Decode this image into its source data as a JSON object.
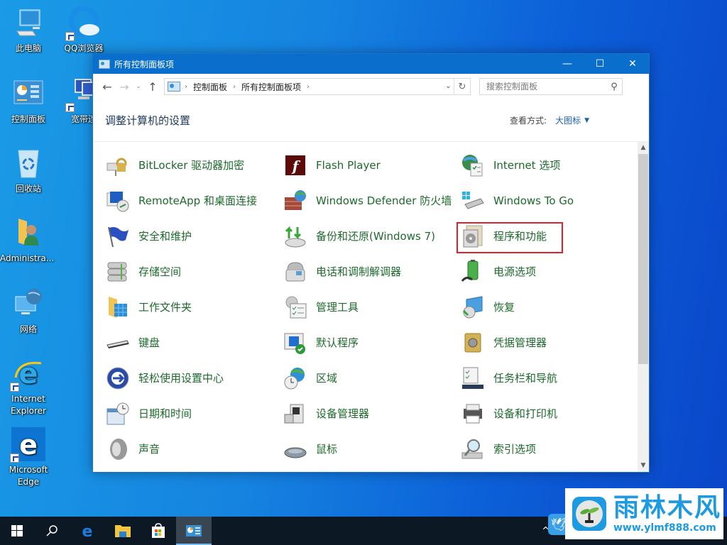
{
  "desktop": {
    "icons": [
      {
        "label": "此电脑",
        "icon": "computer-icon"
      },
      {
        "label": "QQ浏览器",
        "icon": "qq-browser-icon"
      },
      {
        "label": "控制面板",
        "icon": "control-panel-icon"
      },
      {
        "label": "宽带连",
        "icon": "broadband-icon"
      },
      {
        "label": "回收站",
        "icon": "recycle-bin-icon"
      },
      {
        "label": "Administra...",
        "icon": "user-folder-icon"
      },
      {
        "label": "网络",
        "icon": "network-icon"
      },
      {
        "label": "Internet Explorer",
        "icon": "ie-icon"
      },
      {
        "label": "Microsoft Edge",
        "icon": "edge-icon"
      }
    ]
  },
  "window": {
    "title": "所有控制面板项",
    "controls": {
      "minimize": "—",
      "maximize": "☐",
      "close": "✕"
    },
    "nav": {
      "back": "←",
      "forward": "→",
      "recent": "⌄",
      "up": "↑"
    },
    "breadcrumb": [
      "控制面板",
      "所有控制面板项"
    ],
    "search_placeholder": "搜索控制面板",
    "page_title": "调整计算机的设置",
    "view_by_label": "查看方式:",
    "view_by_value": "大图标",
    "highlighted_item": "程序和功能",
    "items": [
      {
        "label": "BitLocker 驱动器加密",
        "icon": "bitlocker-icon"
      },
      {
        "label": "Flash Player",
        "icon": "flash-player-icon"
      },
      {
        "label": "Internet 选项",
        "icon": "internet-options-icon"
      },
      {
        "label": "RemoteApp 和桌面连接",
        "icon": "remoteapp-icon"
      },
      {
        "label": "Windows Defender 防火墙",
        "icon": "firewall-icon"
      },
      {
        "label": "Windows To Go",
        "icon": "windows-to-go-icon"
      },
      {
        "label": "安全和维护",
        "icon": "security-flag-icon"
      },
      {
        "label": "备份和还原(Windows 7)",
        "icon": "backup-restore-icon"
      },
      {
        "label": "程序和功能",
        "icon": "programs-features-icon"
      },
      {
        "label": "存储空间",
        "icon": "storage-spaces-icon"
      },
      {
        "label": "电话和调制解调器",
        "icon": "phone-modem-icon"
      },
      {
        "label": "电源选项",
        "icon": "power-options-icon"
      },
      {
        "label": "工作文件夹",
        "icon": "work-folders-icon"
      },
      {
        "label": "管理工具",
        "icon": "admin-tools-icon"
      },
      {
        "label": "恢复",
        "icon": "recovery-icon"
      },
      {
        "label": "键盘",
        "icon": "keyboard-icon"
      },
      {
        "label": "默认程序",
        "icon": "default-programs-icon"
      },
      {
        "label": "凭据管理器",
        "icon": "credential-manager-icon"
      },
      {
        "label": "轻松使用设置中心",
        "icon": "ease-of-access-icon"
      },
      {
        "label": "区域",
        "icon": "region-icon"
      },
      {
        "label": "任务栏和导航",
        "icon": "taskbar-navigation-icon"
      },
      {
        "label": "日期和时间",
        "icon": "date-time-icon"
      },
      {
        "label": "设备管理器",
        "icon": "device-manager-icon"
      },
      {
        "label": "设备和打印机",
        "icon": "devices-printers-icon"
      },
      {
        "label": "声音",
        "icon": "sound-icon"
      },
      {
        "label": "鼠标",
        "icon": "mouse-icon"
      },
      {
        "label": "索引选项",
        "icon": "indexing-options-icon"
      }
    ]
  },
  "taskbar": {
    "buttons": [
      "start-icon",
      "search-icon",
      "edge-icon",
      "file-explorer-icon",
      "store-icon",
      "control-panel-icon"
    ],
    "active": "control-panel-icon"
  },
  "watermark": {
    "brand": "雨林木风",
    "url": "www.ylmf888.com"
  },
  "colors": {
    "titlebar": "#0a6fcc",
    "item_text": "#1d6a2c",
    "highlight_border": "#d9242d",
    "watermark": "#1e9be0"
  }
}
